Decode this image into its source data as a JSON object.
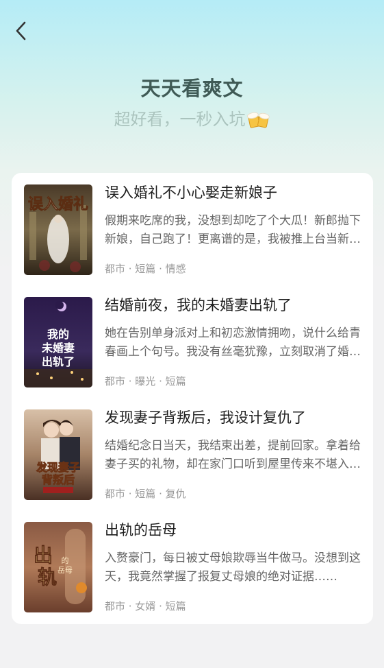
{
  "header": {
    "title": "天天看爽文",
    "subtitle": "超好看，一秒入坑"
  },
  "icons": {
    "back": "chevron-left-icon",
    "subtitle_emoji": "beer-mugs-icon"
  },
  "books": [
    {
      "title": "误入婚礼不小心娶走新娘子",
      "description": "假期来吃席的我，没想到却吃了个大瓜！新郎抛下新娘，自己跑了！更离谱的是，我被推上台当新郎，娶走了新娘子……",
      "tags": "都市 · 短篇 · 情感",
      "cover_text": "误入婚礼"
    },
    {
      "title": "结婚前夜，我的未婚妻出轨了",
      "description": "她在告别单身派对上和初恋激情拥吻，说什么给青春画上个句号。我没有丝毫犹豫，立刻取消了婚礼……",
      "tags": "都市 · 曝光 · 短篇",
      "cover_text": "我的未婚妻出轨了"
    },
    {
      "title": "发现妻子背叛后，我设计复仇了",
      "description": "结婚纪念日当天，我结束出差，提前回家。拿着给妻子买的礼物，却在家门口听到屋里传来不堪入耳的声音……",
      "tags": "都市 · 短篇 · 复仇",
      "cover_text": "发现妻子背叛后"
    },
    {
      "title": "出轨的岳母",
      "description": "入赘豪门，每日被丈母娘欺辱当牛做马。没想到这天，我竟然掌握了报复丈母娘的绝对证据……",
      "tags": "都市 · 女婿 · 短篇",
      "cover_text": "出轨的岳母"
    }
  ]
}
